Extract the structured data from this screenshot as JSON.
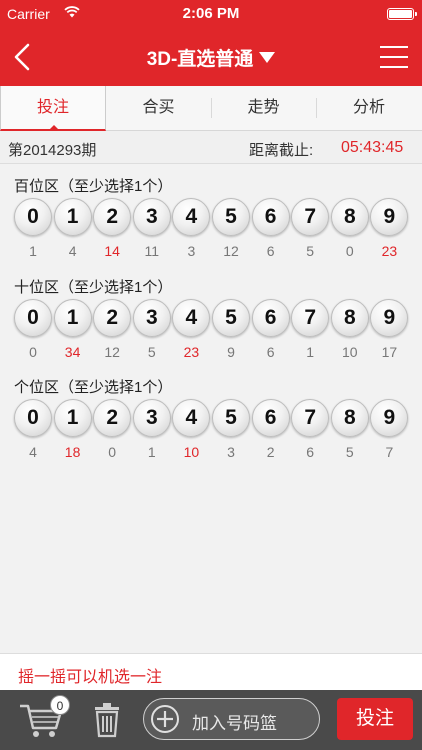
{
  "status_bar": {
    "carrier": "Carrier",
    "time": "2:06 PM"
  },
  "nav": {
    "title": "3D-直选普通"
  },
  "tabs": [
    {
      "label": "投注",
      "active": true
    },
    {
      "label": "合买",
      "active": false
    },
    {
      "label": "走势",
      "active": false
    },
    {
      "label": "分析",
      "active": false
    }
  ],
  "issue_bar": {
    "issue": "第2014293期",
    "deadline_label": "距离截止:",
    "deadline": "05:43:45"
  },
  "zones": [
    {
      "title": "百位区（至少选择1个）",
      "numbers": [
        "0",
        "1",
        "2",
        "3",
        "4",
        "5",
        "6",
        "7",
        "8",
        "9"
      ],
      "counts": [
        1,
        4,
        14,
        11,
        3,
        12,
        6,
        5,
        0,
        23
      ],
      "hot": [
        false,
        false,
        true,
        false,
        false,
        false,
        false,
        false,
        false,
        true
      ]
    },
    {
      "title": "十位区（至少选择1个）",
      "numbers": [
        "0",
        "1",
        "2",
        "3",
        "4",
        "5",
        "6",
        "7",
        "8",
        "9"
      ],
      "counts": [
        0,
        34,
        12,
        5,
        23,
        9,
        6,
        1,
        10,
        17
      ],
      "hot": [
        false,
        true,
        false,
        false,
        true,
        false,
        false,
        false,
        false,
        false
      ]
    },
    {
      "title": "个位区（至少选择1个）",
      "numbers": [
        "0",
        "1",
        "2",
        "3",
        "4",
        "5",
        "6",
        "7",
        "8",
        "9"
      ],
      "counts": [
        4,
        18,
        0,
        1,
        10,
        3,
        2,
        6,
        5,
        7
      ],
      "hot": [
        false,
        true,
        false,
        false,
        true,
        false,
        false,
        false,
        false,
        false
      ]
    }
  ],
  "shake_hint": "摇一摇可以机选一注",
  "bottom_bar": {
    "cart_count": "0",
    "add_label": "加入号码篮",
    "bet_label": "投注"
  },
  "colors": {
    "accent": "#e0262a",
    "bottom_bar": "#4a4a4a",
    "hot_count": "#e0262a"
  }
}
